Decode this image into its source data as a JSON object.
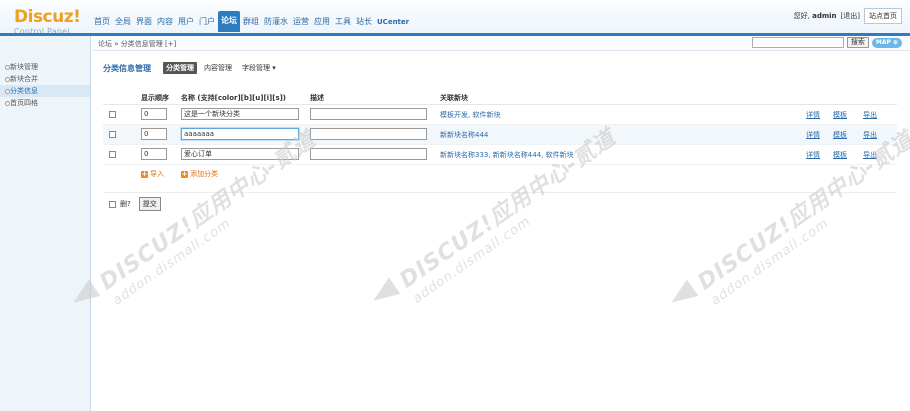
{
  "logo": {
    "main": "Discuz!",
    "sub": "Control Panel"
  },
  "nav": {
    "items": [
      "首页",
      "全局",
      "界面",
      "内容",
      "用户",
      "门户",
      "论坛",
      "群组",
      "防灌水",
      "运营",
      "应用",
      "工具",
      "站长",
      "UCenter"
    ],
    "active_index": 6
  },
  "header": {
    "greet_prefix": "您好, ",
    "user": "admin",
    "logout": "[退出]",
    "site_home": "站点首页"
  },
  "breadcrumb": "论坛 » 分类信息管理  [+]",
  "search": {
    "button": "搜索",
    "map": "MAP ⊕"
  },
  "sidebar": {
    "items": [
      "新块管理",
      "新块合并",
      "分类信息",
      "首页四格"
    ],
    "active_index": 2
  },
  "title": {
    "text": "分类信息管理",
    "tabs": [
      "分类管理",
      "内容管理",
      "字段管理 ▾"
    ],
    "active_tab": 0
  },
  "table": {
    "headers": {
      "order": "显示顺序",
      "name": "名称 (支持[color][b][u][i][s])",
      "desc": "描述",
      "related": "关联新块"
    },
    "rows": [
      {
        "order": "0",
        "name": "这是一个新块分类",
        "desc": "",
        "related": "模板开发, 软件新块",
        "highlight": false,
        "focus": false
      },
      {
        "order": "0",
        "name": "aaaaaaa",
        "desc": "",
        "related": "新新块名称444",
        "highlight": true,
        "focus": true
      },
      {
        "order": "0",
        "name": "爱心订单",
        "desc": "",
        "related": "新新块名称333, 新新块名称444, 软件新块",
        "highlight": false,
        "focus": false
      }
    ],
    "actions": {
      "detail": "详情",
      "template": "模板",
      "export": "导出"
    },
    "add": {
      "import": "导入",
      "add_category": "添加分类"
    }
  },
  "footer": {
    "delete_label": "删?",
    "submit": "提交"
  },
  "watermark": {
    "line1": "DISCUZ!应用中心-贰道",
    "line2": "addon.dismall.com"
  },
  "colors": {
    "accent": "#2d7cc0",
    "logo": "#f0a020",
    "link": "#2b6aa8",
    "add": "#e07010"
  }
}
